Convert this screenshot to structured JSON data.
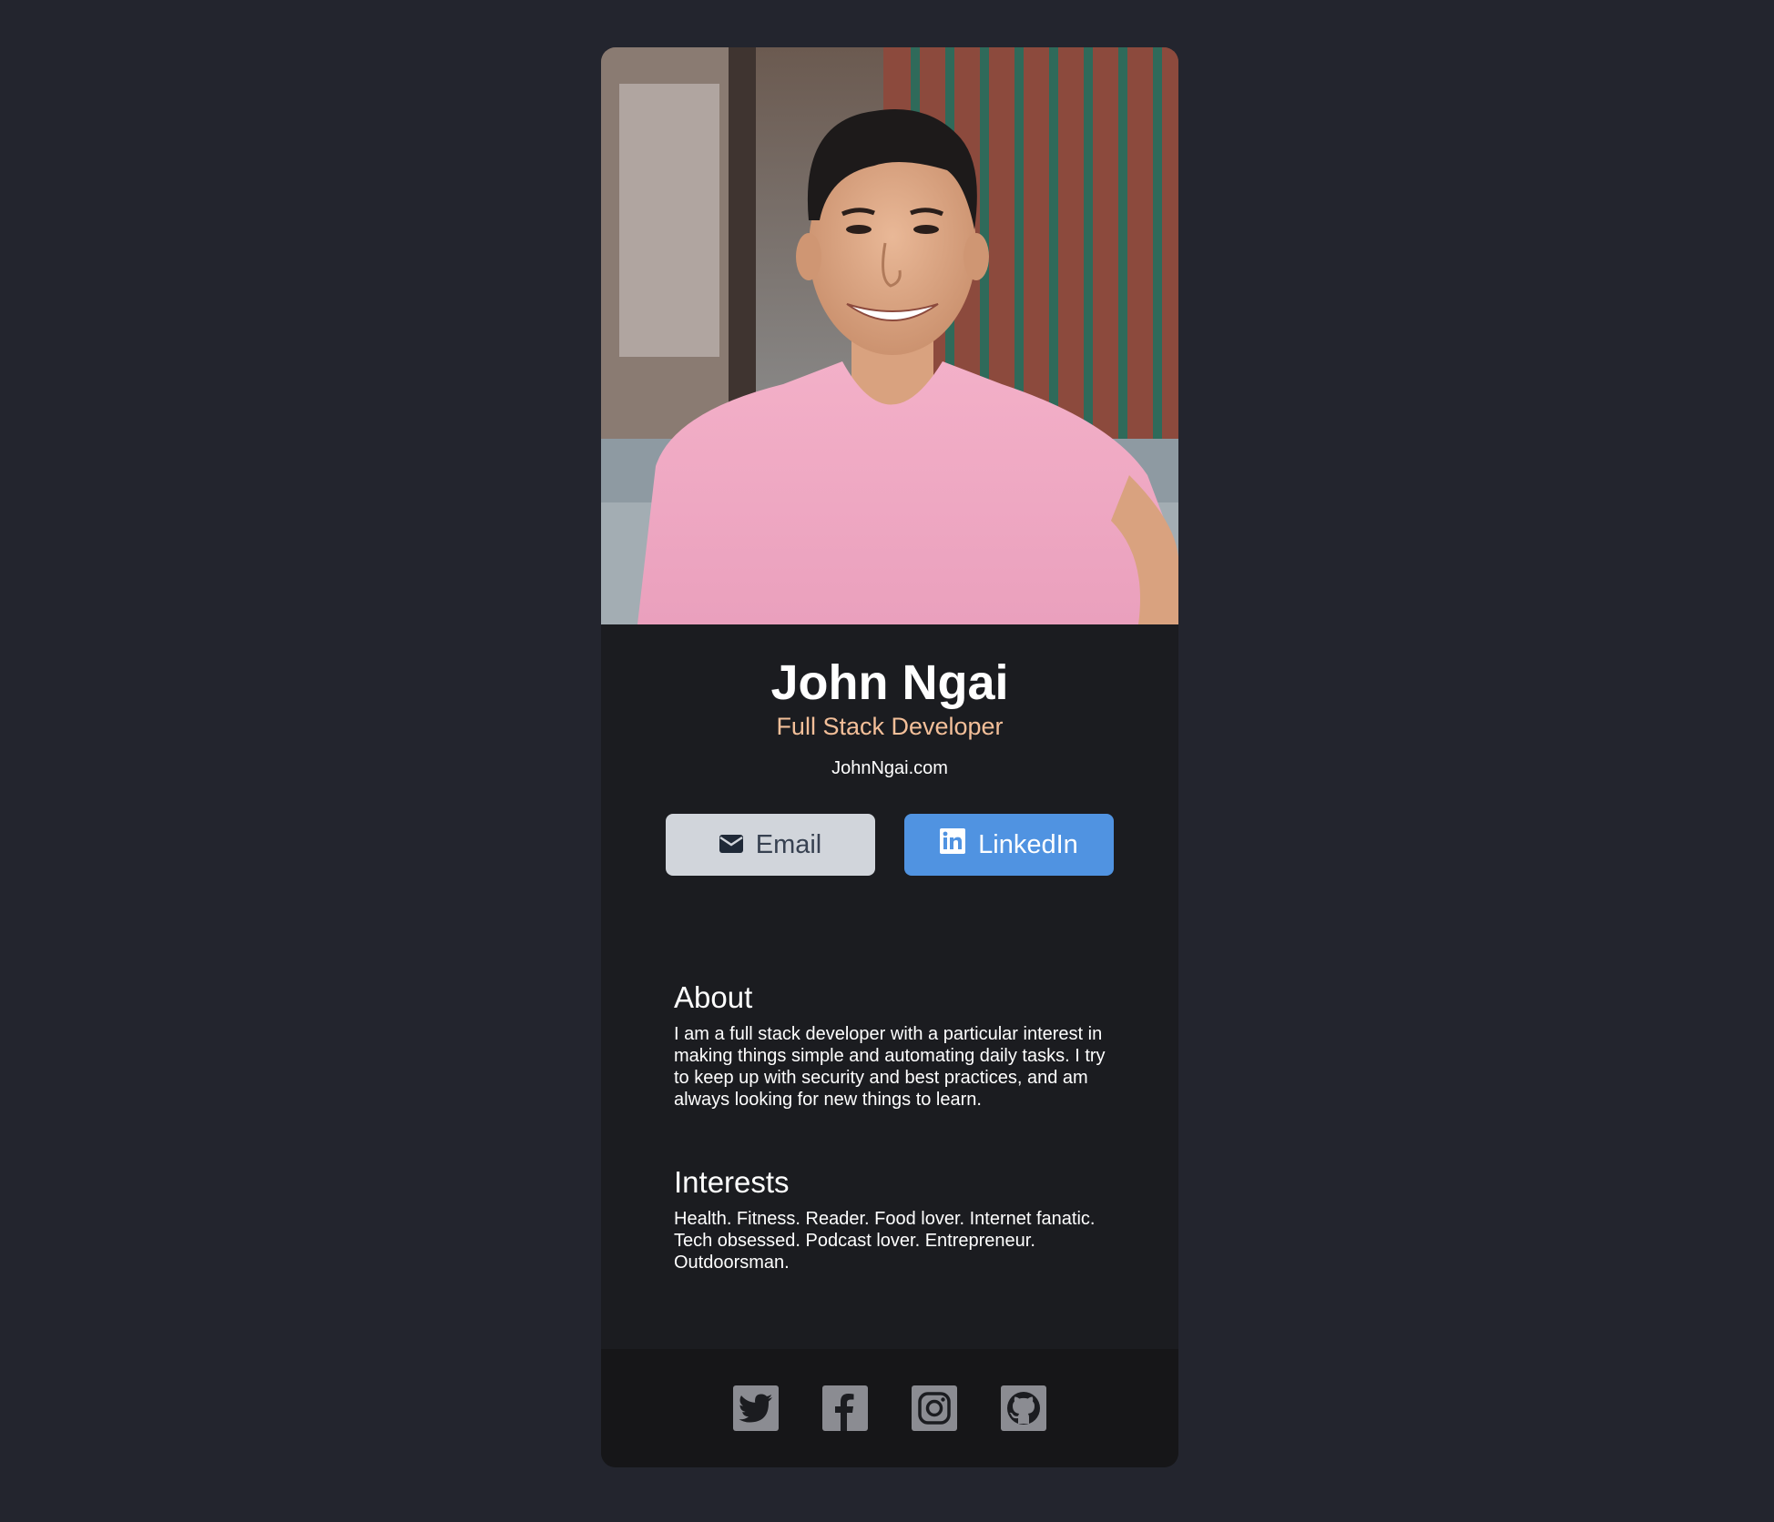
{
  "profile": {
    "name": "John Ngai",
    "role": "Full Stack Developer",
    "website": "JohnNgai.com"
  },
  "buttons": {
    "email_label": "Email",
    "email_icon": "envelope-icon",
    "linkedin_label": "LinkedIn",
    "linkedin_icon": "linkedin-icon"
  },
  "about": {
    "heading": "About",
    "body": "I am a full stack developer with a particular interest in making things simple and automating daily tasks. I try to keep up with security and best practices, and am always looking for new things to learn."
  },
  "interests": {
    "heading": "Interests",
    "body": "Health. Fitness. Reader. Food lover. Internet fanatic. Tech obsessed. Podcast lover. Entrepreneur. Outdoorsman."
  },
  "footer": {
    "social_icons": [
      "twitter-icon",
      "facebook-icon",
      "instagram-icon",
      "github-icon"
    ]
  },
  "colors": {
    "page_background": "#23252e",
    "card_background": "#1b1c20",
    "footer_background": "#161618",
    "role_accent": "#f3bf99",
    "linkedin_button": "#5093e1",
    "email_button": "#d1d5db"
  }
}
